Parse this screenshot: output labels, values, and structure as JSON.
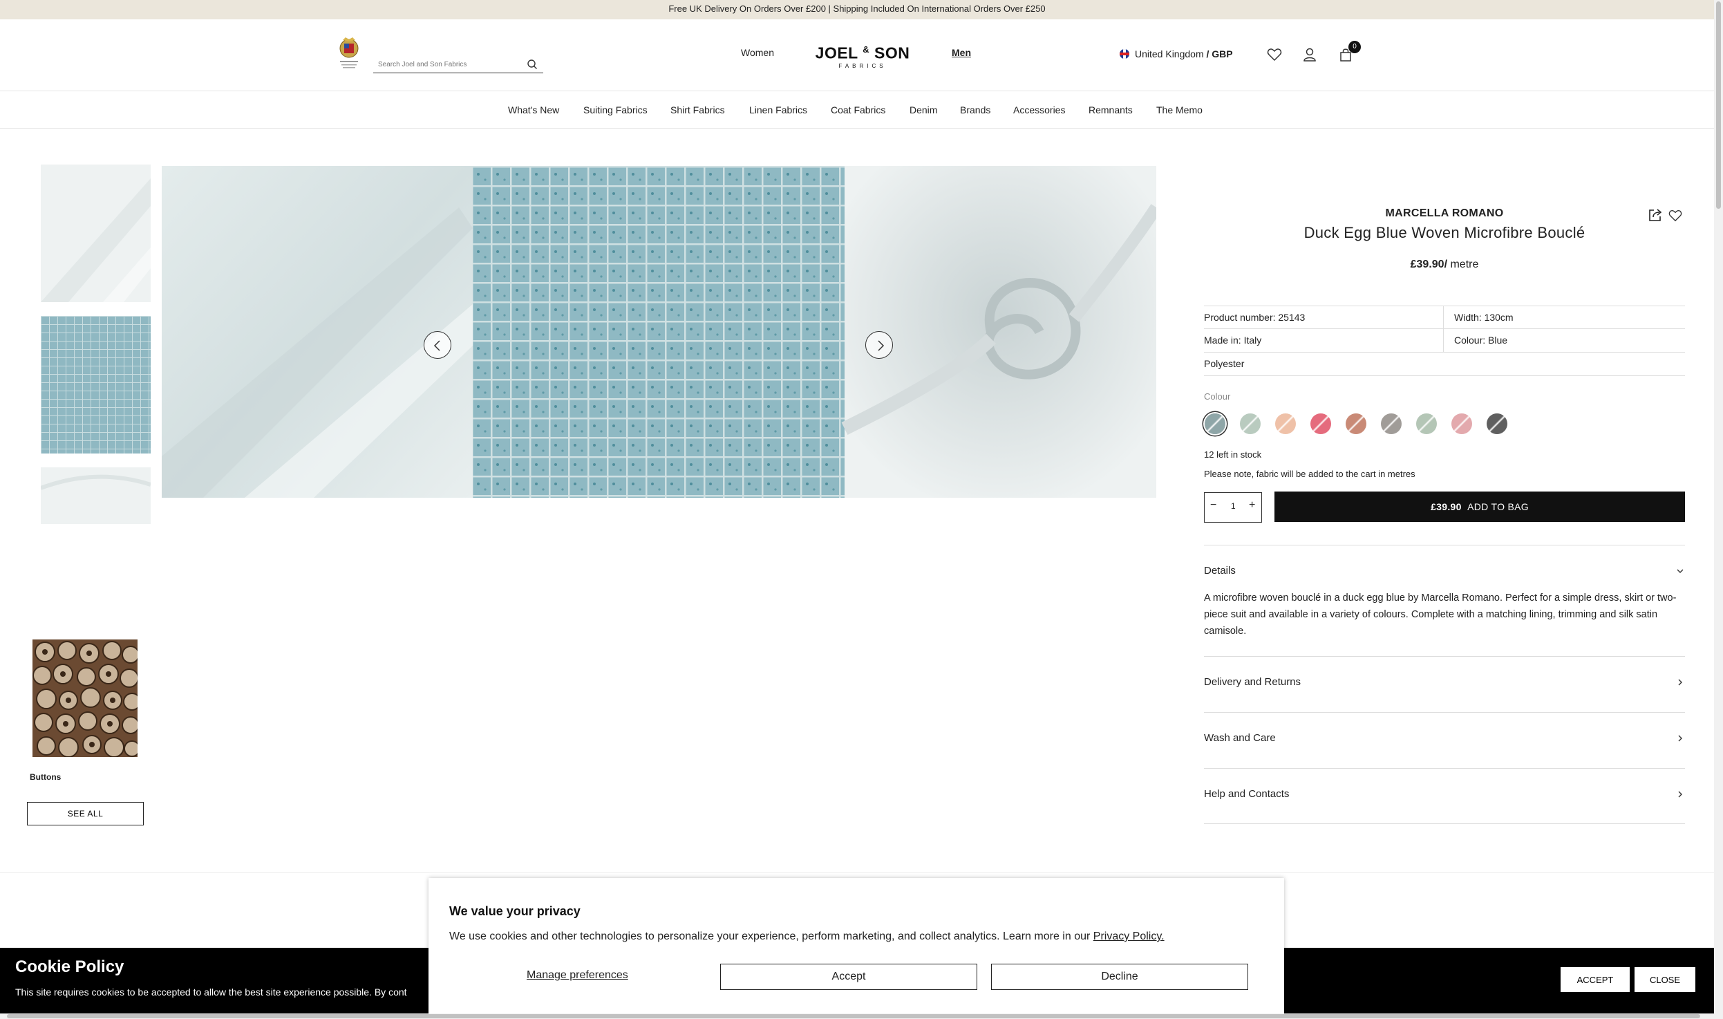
{
  "topbar": {
    "text": "Free UK Delivery On Orders Over £200 | Shipping Included On International Orders Over £250"
  },
  "header": {
    "search_placeholder": "Search Joel and Son Fabrics",
    "women": "Women",
    "men": "Men",
    "logo_main": "JOEL",
    "logo_amp": "&",
    "logo_son": "SON",
    "logo_sub": "FABRICS",
    "country": "United Kingdom",
    "sep": "/",
    "currency": "GBP",
    "cart_count": "0"
  },
  "nav": {
    "items": [
      "What's New",
      "Suiting Fabrics",
      "Shirt Fabrics",
      "Linen Fabrics",
      "Coat Fabrics",
      "Denim",
      "Brands",
      "Accessories",
      "Remnants",
      "The Memo"
    ]
  },
  "related": {
    "label": "Buttons",
    "see_all": "SEE ALL"
  },
  "product": {
    "brand": "MARCELLA ROMANO",
    "title": "Duck Egg Blue Woven Microfibre Bouclé",
    "price": "£39.90/",
    "unit": " metre",
    "specs": {
      "product_number": "Product number: 25143",
      "width": "Width: 130cm",
      "made_in": "Made in: Italy",
      "colour": "Colour: Blue",
      "composition": "Polyester"
    },
    "colour_label": "Colour",
    "swatch_colors": [
      "#8fa6a8",
      "#b9cbbf",
      "#efc1a8",
      "#e56b7d",
      "#c98a76",
      "#a09c98",
      "#b4c6b6",
      "#e3a9ad",
      "#5f5f5f"
    ],
    "stock": "12 left in stock",
    "note": "Please note, fabric will be added to the cart in metres",
    "qty_minus": "−",
    "qty_value": "1",
    "qty_plus": "+",
    "add_price": "£39.90",
    "add_label": "ADD TO BAG"
  },
  "accordions": {
    "details_title": "Details",
    "details_body": "A microfibre woven bouclé in a duck egg blue by Marcella Romano. Perfect for a simple dress, skirt or two-piece suit and available in a variety of colours. Complete with a matching lining, trimming and silk satin camisole.",
    "delivery": "Delivery and Returns",
    "wash": "Wash and Care",
    "help": "Help and Contacts"
  },
  "cookie_bar": {
    "title": "Cookie Policy",
    "text": "This site requires cookies to be accepted to allow the best site experience possible. By cont",
    "accept": "ACCEPT",
    "close": "CLOSE"
  },
  "privacy_modal": {
    "title": "We value your privacy",
    "text": "We use cookies and other technologies to personalize your experience, perform marketing, and collect analytics. Learn more in our ",
    "link": "Privacy Policy.",
    "manage": "Manage preferences",
    "accept": "Accept",
    "decline": "Decline"
  }
}
